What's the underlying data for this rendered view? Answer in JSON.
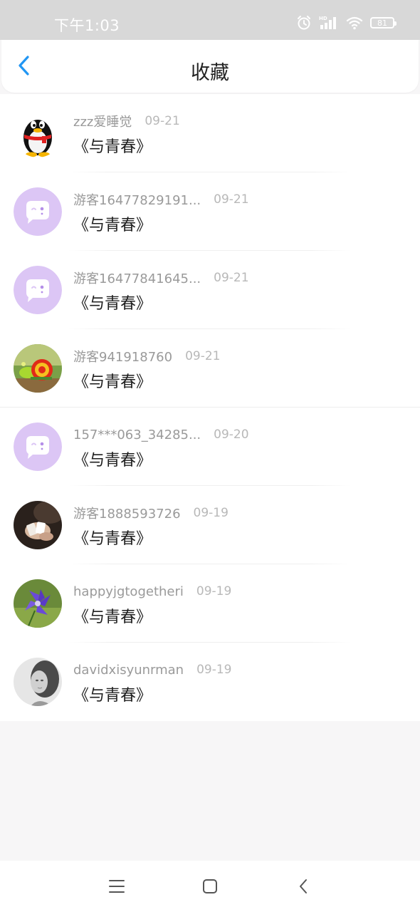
{
  "status_bar": {
    "time": "下午1:03",
    "battery": "81",
    "icons": [
      "alarm-icon",
      "hd-signal-icon",
      "wifi-icon",
      "battery-icon"
    ]
  },
  "header": {
    "back_icon": "chevron-left-icon",
    "title": "收藏"
  },
  "favorites": [
    {
      "username": "zzz爱睡觉",
      "date": "09-21",
      "title": "《与青春》",
      "avatar": "qq-penguin"
    },
    {
      "username": "游客16477829191...",
      "date": "09-21",
      "title": "《与青春》",
      "avatar": "default-chat-bubble"
    },
    {
      "username": "游客16477841645...",
      "date": "09-21",
      "title": "《与青春》",
      "avatar": "default-chat-bubble"
    },
    {
      "username": "游客941918760",
      "date": "09-21",
      "title": "《与青春》",
      "avatar": "snail-toy-photo"
    },
    {
      "username": "157***063_34285...",
      "date": "09-20",
      "title": "《与青春》",
      "avatar": "default-chat-bubble"
    },
    {
      "username": "游客1888593726",
      "date": "09-19",
      "title": "《与青春》",
      "avatar": "hands-cards-photo"
    },
    {
      "username": "happyjgtogetheri",
      "date": "09-19",
      "title": "《与青春》",
      "avatar": "purple-flower-photo"
    },
    {
      "username": "davidxisyunrman",
      "date": "09-19",
      "title": "《与青春》",
      "avatar": "grayscale-portrait-photo"
    }
  ],
  "nav_bar": {
    "items": [
      "menu-icon",
      "home-icon",
      "back-icon"
    ]
  },
  "colors": {
    "accent": "#2196f3",
    "status_bar_bg": "#d8d8d8",
    "default_avatar_bg": "#dcc6f5",
    "page_bg": "#f7f6f7"
  }
}
